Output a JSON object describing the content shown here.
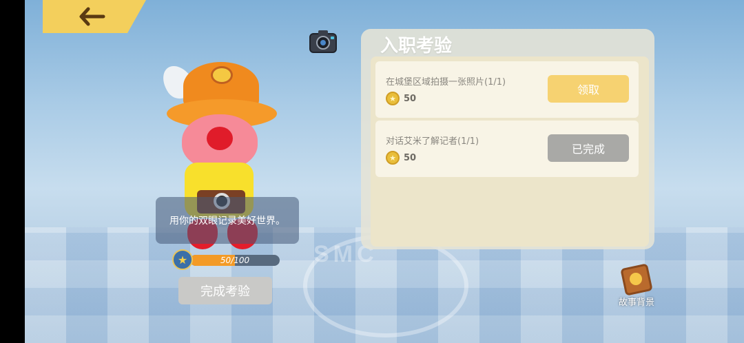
{
  "colors": {
    "accent": "#f3cf5c",
    "claim_button": "#f6d271",
    "done_button": "#a9a9a6",
    "xp_fill": "#f39a26"
  },
  "header": {
    "back_icon": "back-arrow-icon",
    "camera_icon": "camera-icon"
  },
  "character": {
    "caption": "用你的双眼记录美好世界。",
    "floor_logo": "SMC",
    "xp": {
      "text": "50/100",
      "current": 50,
      "max": 100,
      "fraction": 0.5
    },
    "complete_button": "完成考验"
  },
  "panel": {
    "title": "入职考验",
    "tasks": [
      {
        "title": "在城堡区域拍摄一张照片(1/1)",
        "reward": "50",
        "button": "领取",
        "state": "claimable"
      },
      {
        "title": "对话艾米了解记者(1/1)",
        "reward": "50",
        "button": "已完成",
        "state": "completed"
      }
    ]
  },
  "story": {
    "label": "故事背景",
    "icon": "story-book-icon"
  }
}
